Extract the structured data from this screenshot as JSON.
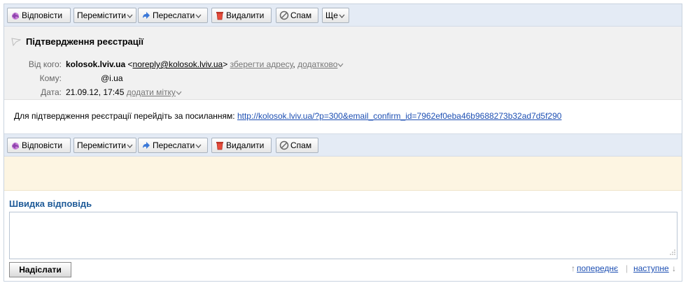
{
  "toolbar_top": {
    "reply": "Відповісти",
    "move": "Перемістити",
    "forward": "Переслати",
    "delete": "Видалити",
    "spam": "Спам",
    "more": "Ще"
  },
  "toolbar_bottom": {
    "reply": "Відповісти",
    "move": "Перемістити",
    "forward": "Переслати",
    "delete": "Видалити",
    "spam": "Спам"
  },
  "message": {
    "subject": "Підтвердження реєстрації",
    "from_label": "Від кого:",
    "from_name": "kolosok.lviv.ua",
    "from_email_open": "<",
    "from_email": "noreply@kolosok.lviv.ua",
    "from_email_close": ">",
    "save_address": "зберегти адресу",
    "comma": ",",
    "more_info": "додатково",
    "to_label": "Кому:",
    "to_value": "@i.ua",
    "date_label": "Дата:",
    "date_value": "21.09.12, 17:45",
    "add_tag": "додати мітку",
    "body_text": "Для підтвердження реєстрації перейдіть за посиланням:",
    "body_link": "http://kolosok.lviv.ua/?p=300&email_confirm_id=7962ef0eba46b9688273b32ad7d5f290"
  },
  "quick_reply": {
    "title": "Швидка відповідь",
    "text": "",
    "send": "Надіслати"
  },
  "pager": {
    "up_arrow": "↑",
    "prev": "попереднє",
    "sep": "|",
    "next": "наступне",
    "down_arrow": "↓"
  },
  "colors": {
    "toolbar_bg": "#e4ebf5",
    "header_bg": "#f1f1f1",
    "notice_bg": "#fdf5e2",
    "link": "#1d4fb3",
    "quick_reply_title": "#1f5b98"
  }
}
